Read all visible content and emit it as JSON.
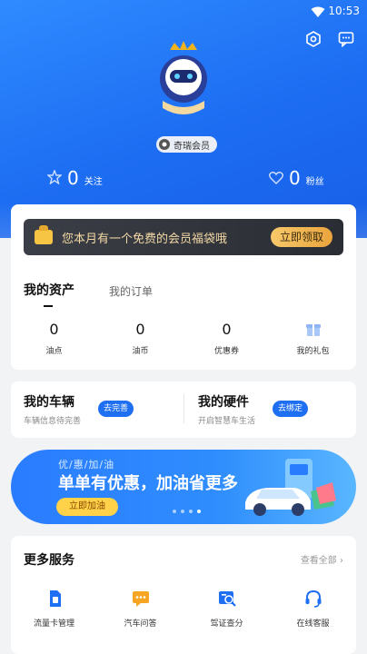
{
  "status": {
    "time": "10:53"
  },
  "header": {
    "member_badge": "奇瑞会员",
    "follow": {
      "count": "0",
      "label": "关注"
    },
    "fans": {
      "count": "0",
      "label": "粉丝"
    }
  },
  "gift_banner": {
    "text": "您本月有一个免费的会员福袋哦",
    "button": "立即领取"
  },
  "assets": {
    "tabs": [
      "我的资产",
      "我的订单"
    ],
    "items": [
      {
        "value": "0",
        "label": "油点"
      },
      {
        "value": "0",
        "label": "油币"
      },
      {
        "value": "0",
        "label": "优惠券"
      },
      {
        "value": "",
        "label": "我的礼包"
      }
    ]
  },
  "vehicle": {
    "title": "我的车辆",
    "sub": "车辆信息待完善",
    "button": "去完善"
  },
  "hardware": {
    "title": "我的硬件",
    "sub": "开启智慧车生活",
    "button": "去绑定"
  },
  "promo": {
    "small": "优/惠/加/油",
    "big": "单单有优惠，加油省更多",
    "button": "立即加油"
  },
  "services": {
    "title": "更多服务",
    "all": "查看全部",
    "items": [
      {
        "label": "流量卡管理",
        "icon": "sim-card-icon"
      },
      {
        "label": "汽车问答",
        "icon": "chat-icon"
      },
      {
        "label": "驾证查分",
        "icon": "license-search-icon"
      },
      {
        "label": "在线客服",
        "icon": "headset-icon"
      }
    ]
  },
  "colors": {
    "primary": "#1e6ff1",
    "gold": "#f4d9a6"
  }
}
